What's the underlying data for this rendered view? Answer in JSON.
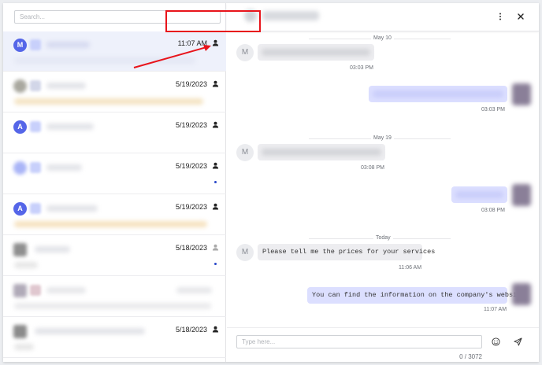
{
  "sidebar": {
    "search_placeholder": "Search...",
    "conversations": [
      {
        "avatar_letter": "M",
        "date": "11:07 AM",
        "unread": false,
        "user_icon": "user-icon"
      },
      {
        "avatar_letter": "",
        "date": "5/19/2023",
        "unread": false,
        "user_icon": "user-icon"
      },
      {
        "avatar_letter": "A",
        "date": "5/19/2023",
        "unread": false,
        "user_icon": "user-icon"
      },
      {
        "avatar_letter": "",
        "date": "5/19/2023",
        "unread": true,
        "user_icon": "user-icon"
      },
      {
        "avatar_letter": "A",
        "date": "5/19/2023",
        "unread": false,
        "user_icon": "user-icon"
      },
      {
        "avatar_letter": "",
        "date": "5/18/2023",
        "unread": true,
        "user_icon": "user-icon"
      },
      {
        "avatar_letter": "",
        "date": "",
        "unread": false,
        "user_icon": ""
      },
      {
        "avatar_letter": "",
        "date": "5/18/2023",
        "unread": false,
        "user_icon": "user-icon"
      }
    ]
  },
  "chat": {
    "header_icons": [
      "more-vertical-icon",
      "close-icon"
    ],
    "days": [
      "May 10",
      "May 19",
      "Today"
    ],
    "messages": [
      {
        "direction": "in",
        "avatar_letter": "M",
        "text": "",
        "time": "03:03 PM"
      },
      {
        "direction": "out",
        "text": "",
        "time": "03:03 PM"
      },
      {
        "direction": "in",
        "avatar_letter": "M",
        "text": "",
        "time": "03:08 PM"
      },
      {
        "direction": "out",
        "text": "",
        "time": "03:08 PM"
      },
      {
        "direction": "in",
        "avatar_letter": "M",
        "text": "Please tell me the prices for your services",
        "time": "11:06 AM"
      },
      {
        "direction": "out",
        "text": "You can find the information on the company's website",
        "time": "11:07 AM"
      }
    ]
  },
  "composer": {
    "placeholder": "Type here...",
    "char_count": "0 / 3072",
    "icons": [
      "emoji-icon",
      "send-icon"
    ]
  },
  "colors": {
    "accent": "#5566e8",
    "annotation": "#e8141b",
    "outgoing_bubble": "#dcdfff",
    "incoming_bubble": "#ededf0"
  }
}
